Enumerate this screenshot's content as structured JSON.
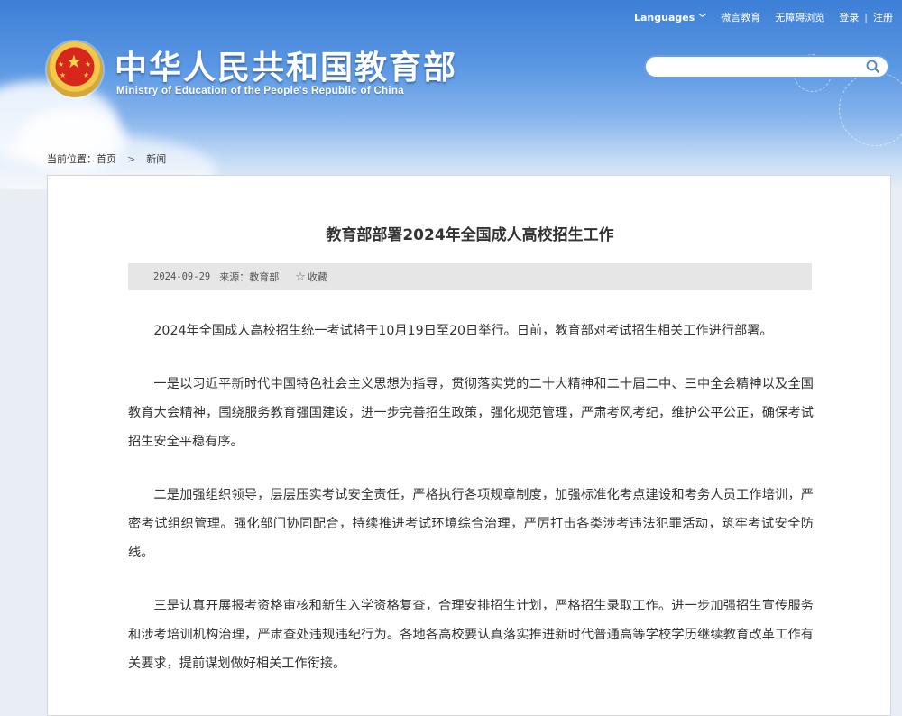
{
  "topnav": {
    "languages": "Languages",
    "weibo": "微言教育",
    "accessibility": "无障碍浏览",
    "login": "登录",
    "separator": "|",
    "register": "注册"
  },
  "site": {
    "title": "中华人民共和国教育部",
    "subtitle": "Ministry of Education of the People's Republic of China"
  },
  "search": {
    "placeholder": "",
    "value": ""
  },
  "breadcrumb": {
    "label": "当前位置：",
    "home": "首页",
    "current": "新闻"
  },
  "article": {
    "title": "教育部部署2024年全国成人高校招生工作",
    "date": "2024-09-29",
    "source": "来源：教育部",
    "favorite": "收藏",
    "paragraphs": [
      "2024年全国成人高校招生统一考试将于10月19日至20日举行。日前，教育部对考试招生相关工作进行部署。",
      "一是以习近平新时代中国特色社会主义思想为指导，贯彻落实党的二十大精神和二十届二中、三中全会精神以及全国教育大会精神，围绕服务教育强国建设，进一步完善招生政策，强化规范管理，严肃考风考纪，维护公平公正，确保考试招生安全平稳有序。",
      "二是加强组织领导，层层压实考试安全责任，严格执行各项规章制度，加强标准化考点建设和考务人员工作培训，严密考试组织管理。强化部门协同配合，持续推进考试环境综合治理，严厉打击各类涉考违法犯罪活动，筑牢考试安全防线。",
      "三是认真开展报考资格审核和新生入学资格复查，合理安排招生计划，严格招生录取工作。进一步加强招生宣传服务和涉考培训机构治理，严肃查处违规违纪行为。各地各高校要认真落实推进新时代普通高等学校学历继续教育改革工作有关要求，提前谋划做好相关工作衔接。"
    ]
  },
  "colors": {
    "header_top": "#3d7fd6",
    "header_bottom": "#e9eef4",
    "meta_bar": "#e6e6e6",
    "text": "#333333",
    "search_border": "#6aa0df"
  }
}
